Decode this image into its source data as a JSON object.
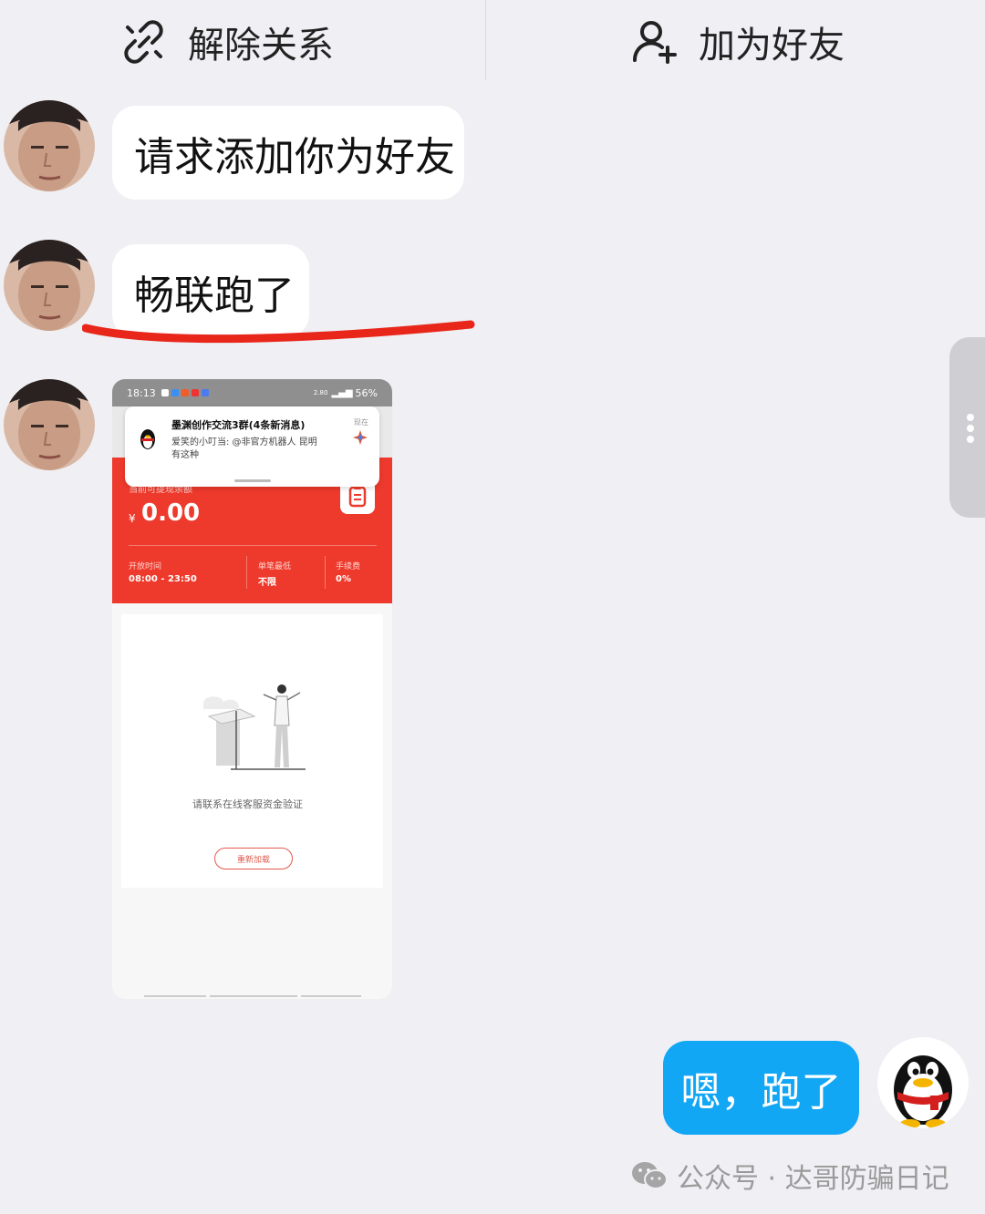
{
  "header": {
    "remove_relation_label": "解除关系",
    "add_friend_label": "加为好友"
  },
  "messages": [
    {
      "text": "请求添加你为好友"
    },
    {
      "text": "畅联跑了"
    }
  ],
  "screenshot": {
    "status_time": "18:13",
    "status_battery": "56%",
    "status_net": "2.80",
    "notification": {
      "title": "墨渊创作交流3群(4条新消息)",
      "time": "现在",
      "line1": "爱笑的小叮当: @非官方机器人 昆明",
      "line2": "有这种"
    },
    "balance_label": "当前可提现余额",
    "currency": "¥",
    "balance": "0.00",
    "open_time_label": "开放时间",
    "open_time": "08:00 - 23:50",
    "min_label": "单笔最低",
    "min_value": "不限",
    "fee_label": "手续费",
    "fee_value": "0%",
    "empty_text": "请联系在线客服资金验证",
    "reload_button": "重新加载"
  },
  "reply": {
    "text": "嗯，跑了"
  },
  "watermark": {
    "text": "公众号 · 达哥防骗日记"
  },
  "colors": {
    "bubble_blue": "#12a7f5",
    "red_panel": "#ee3a2c",
    "underline_red": "#e8261a"
  }
}
